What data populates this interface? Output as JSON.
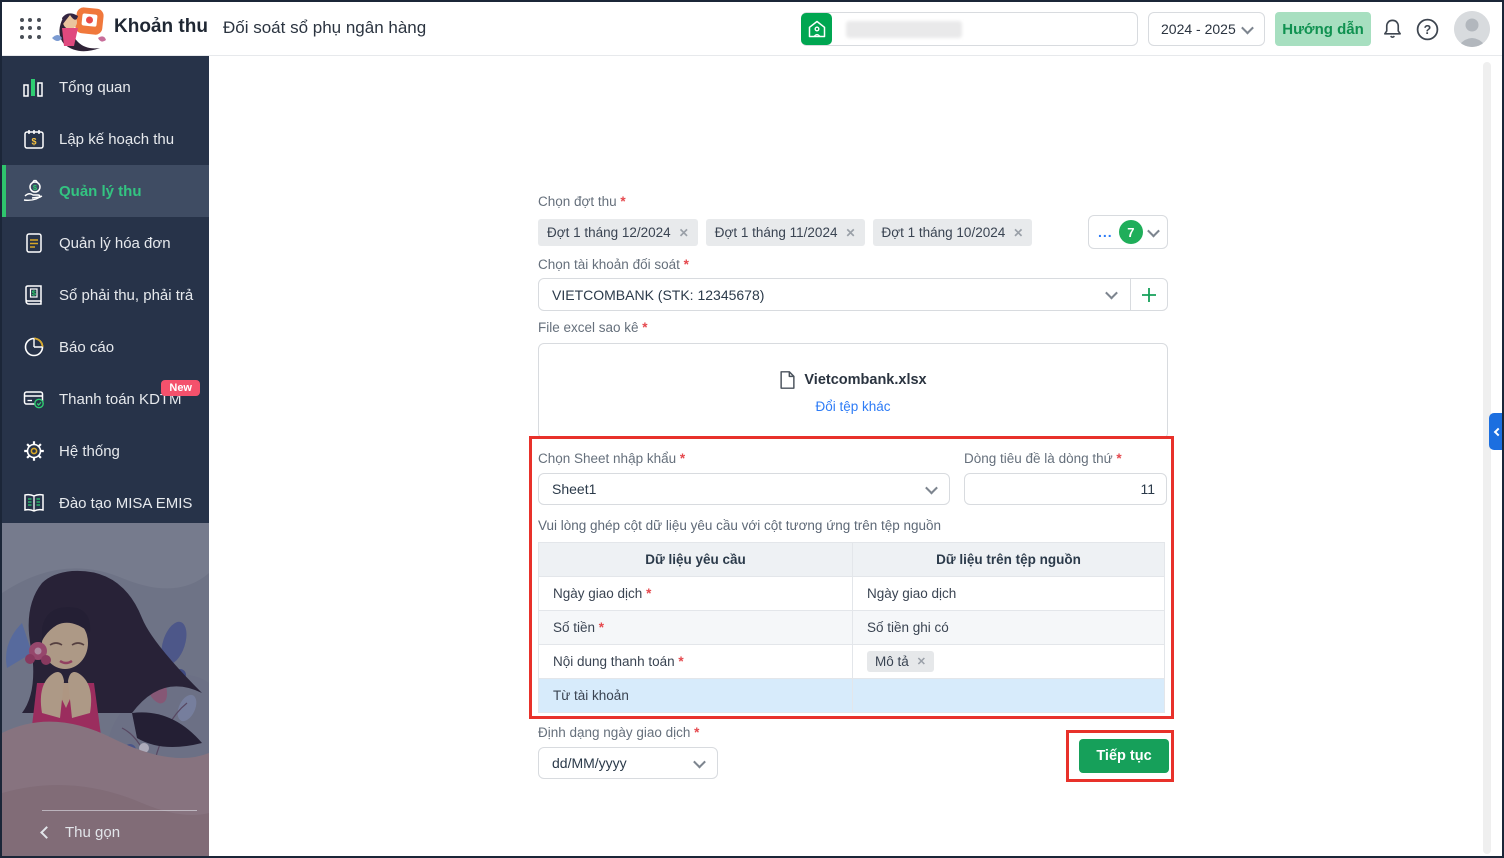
{
  "header": {
    "app_title": "Khoản thu",
    "page_title": "Đối soát sổ phụ ngân hàng",
    "school_year": "2024 - 2025",
    "guide_button": "Hướng dẫn"
  },
  "sidebar": {
    "items": [
      {
        "label": "Tổng quan",
        "icon": "bar-chart-icon"
      },
      {
        "label": "Lập kế hoạch thu",
        "icon": "calendar-dollar-icon"
      },
      {
        "label": "Quản lý thu",
        "icon": "hand-money-icon",
        "active": true
      },
      {
        "label": "Quản lý hóa đơn",
        "icon": "invoice-icon"
      },
      {
        "label": "Sổ phải thu, phải trả",
        "icon": "ledger-icon"
      },
      {
        "label": "Báo cáo",
        "icon": "pie-chart-icon"
      },
      {
        "label": "Thanh toán KDTM",
        "icon": "card-check-icon",
        "badge": "New"
      },
      {
        "label": "Hệ thống",
        "icon": "gear-icon"
      },
      {
        "label": "Đào tạo MISA EMIS",
        "icon": "open-book-icon"
      }
    ],
    "collapse_label": "Thu gọn"
  },
  "form": {
    "batch_label": "Chọn đợt thu",
    "batch_tags": [
      "Đợt 1 tháng 12/2024",
      "Đợt 1 tháng 11/2024",
      "Đợt 1 tháng 10/2024"
    ],
    "batch_more": "...",
    "batch_count": "7",
    "account_label": "Chọn tài khoản đối soát",
    "account_value": "VIETCOMBANK (STK: 12345678)",
    "file_label": "File excel sao kê",
    "file_name": "Vietcombank.xlsx",
    "change_file_link": "Đổi tệp khác",
    "sheet_label": "Chọn Sheet nhập khẩu",
    "sheet_value": "Sheet1",
    "header_row_label": "Dòng tiêu đề là dòng thứ",
    "header_row_value": "11",
    "mapping_hint": "Vui lòng ghép cột dữ liệu yêu cầu với cột tương ứng trên tệp nguồn",
    "date_format_label": "Định dạng ngày giao dịch",
    "date_format_value": "dd/MM/yyyy",
    "continue_button": "Tiếp tục"
  },
  "mapping_table": {
    "headers": [
      "Dữ liệu yêu cầu",
      "Dữ liệu trên tệp nguồn"
    ],
    "rows": [
      {
        "required": "Ngày giao dịch",
        "source": "Ngày giao dịch"
      },
      {
        "required": "Số tiền",
        "source": "Số tiền ghi có"
      },
      {
        "required": "Nội dung thanh toán",
        "source": "Mô tả"
      },
      {
        "required": "Từ tài khoản",
        "source": ""
      }
    ]
  },
  "colors": {
    "accent_green": "#16a05a",
    "sidebar_bg": "#273349",
    "active_green": "#33c481",
    "highlight_red": "#e8312a",
    "link_blue": "#2e7cf6",
    "selected_row_blue": "#d7ebfb",
    "new_badge_red": "#f4516c"
  }
}
